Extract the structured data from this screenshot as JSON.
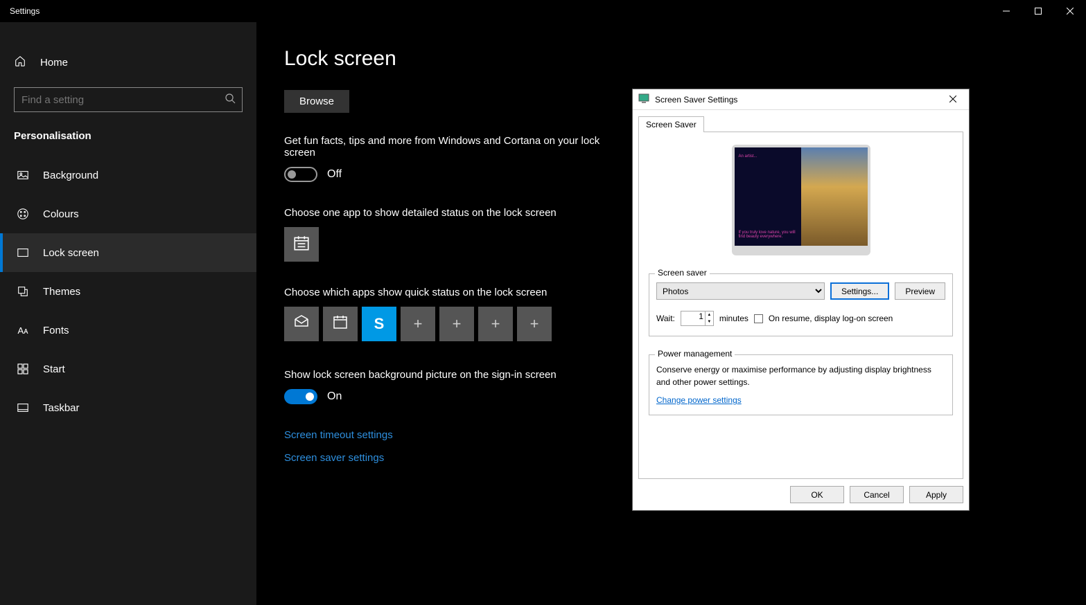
{
  "window": {
    "title": "Settings"
  },
  "sidebar": {
    "home": "Home",
    "search_placeholder": "Find a setting",
    "category": "Personalisation",
    "items": [
      {
        "label": "Background"
      },
      {
        "label": "Colours"
      },
      {
        "label": "Lock screen"
      },
      {
        "label": "Themes"
      },
      {
        "label": "Fonts"
      },
      {
        "label": "Start"
      },
      {
        "label": "Taskbar"
      }
    ]
  },
  "main": {
    "heading": "Lock screen",
    "browse": "Browse",
    "funfacts_label": "Get fun facts, tips and more from Windows and Cortana on your lock screen",
    "funfacts_state": "Off",
    "detailed_label": "Choose one app to show detailed status on the lock screen",
    "quick_label": "Choose which apps show quick status on the lock screen",
    "signin_label": "Show lock screen background picture on the sign-in screen",
    "signin_state": "On",
    "link_timeout": "Screen timeout settings",
    "link_saver": "Screen saver settings"
  },
  "dialog": {
    "title": "Screen Saver Settings",
    "tab": "Screen Saver",
    "group_saver": "Screen saver",
    "dropdown_value": "Photos",
    "btn_settings": "Settings...",
    "btn_preview": "Preview",
    "wait_label": "Wait:",
    "wait_value": "1",
    "minutes": "minutes",
    "resume_label": "On resume, display log-on screen",
    "group_power": "Power management",
    "power_text": "Conserve energy or maximise performance by adjusting display brightness and other power settings.",
    "power_link": "Change power settings",
    "btn_ok": "OK",
    "btn_cancel": "Cancel",
    "btn_apply": "Apply"
  }
}
